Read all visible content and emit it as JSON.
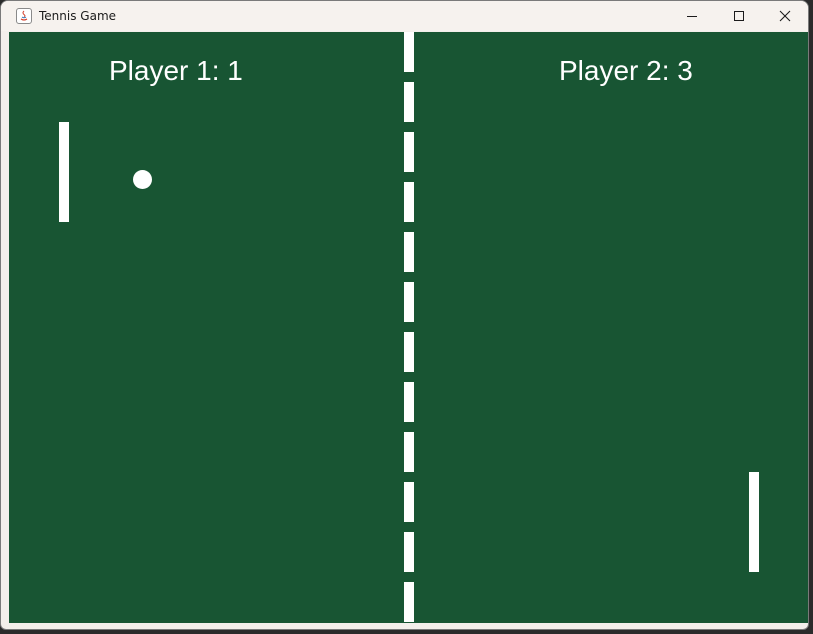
{
  "window": {
    "title": "Tennis Game",
    "app_icon": "java-icon",
    "controls": {
      "minimize_icon": "minimize-icon",
      "maximize_icon": "maximize-icon",
      "close_icon": "close-icon"
    }
  },
  "game": {
    "court_color": "#185533",
    "line_color": "#ffffff",
    "player1_score_text": "Player 1: 1",
    "player2_score_text": "Player 2: 3",
    "player1_score": 1,
    "player2_score": 3
  }
}
